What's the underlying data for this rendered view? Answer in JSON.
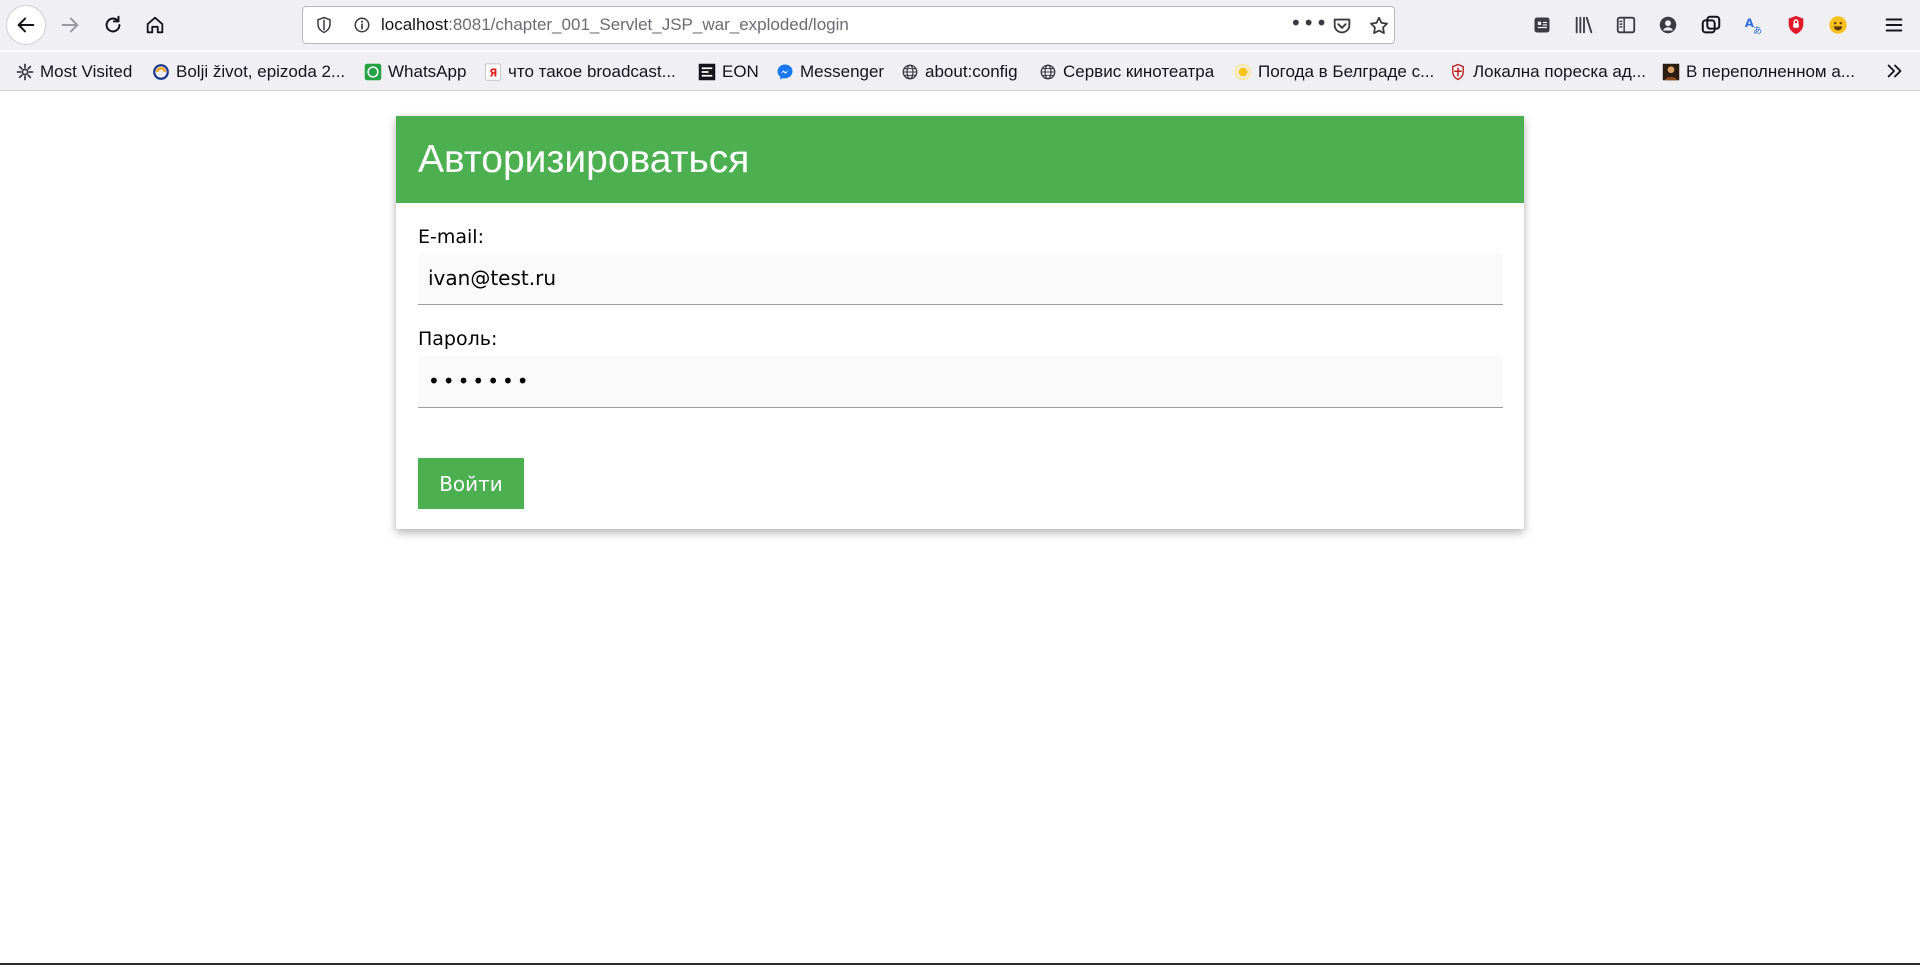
{
  "browser": {
    "url_host": "localhost",
    "url_rest": ":8081/chapter_001_Servlet_JSP_war_exploded/login",
    "more_label": "•••"
  },
  "bookmarks": [
    {
      "label": "Most Visited",
      "icon": "gear-icon"
    },
    {
      "label": "Bolji život, epizoda 2...",
      "icon": "swirl-icon"
    },
    {
      "label": "WhatsApp",
      "icon": "whatsapp-icon"
    },
    {
      "label": "что такое broadcast...",
      "icon": "yandex-icon"
    },
    {
      "label": "EON",
      "icon": "eon-icon"
    },
    {
      "label": "Messenger",
      "icon": "messenger-icon"
    },
    {
      "label": "about:config",
      "icon": "globe-icon"
    },
    {
      "label": "Сервис кинотеатра",
      "icon": "globe-icon"
    },
    {
      "label": "Погода в Белграде с...",
      "icon": "sun-icon"
    },
    {
      "label": "Локална пореска ад...",
      "icon": "crest-icon"
    },
    {
      "label": "В переполненном а...",
      "icon": "portrait-icon"
    }
  ],
  "login": {
    "title": "Авторизироваться",
    "email_label": "E-mail:",
    "email_value": "ivan@test.ru",
    "password_label": "Пароль:",
    "password_value": "•••••••",
    "submit_label": "Войти"
  },
  "colors": {
    "accent": "#4caf50",
    "input_bg": "#fafafa"
  }
}
